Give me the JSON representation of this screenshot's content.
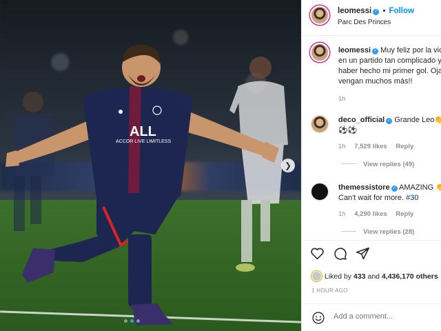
{
  "post": {
    "author": "leomessi",
    "follow_label": "Follow",
    "location": "Parc Des Princes",
    "caption": "Muy feliz por la victoria en un partido tan complicado y por haber hecho mi primer gol. Ojalá vengan muchos más!!",
    "caption_time": "1h"
  },
  "comments": [
    {
      "user": "deco_official",
      "text": "Grande Leo👏",
      "emoji_line": "⚽⚽",
      "time": "1h",
      "likes": "7,529 likes",
      "reply_label": "Reply",
      "view_replies": "View replies (49)"
    },
    {
      "user": "themessistore",
      "text": "AMAZING 👏",
      "text_line2": "Can't wait for more.",
      "hashtag": "#30",
      "time": "1h",
      "likes": "4,290 likes",
      "reply_label": "Reply",
      "view_replies": "View replies (28)"
    }
  ],
  "engagement": {
    "liked_prefix": "Liked by",
    "liked_user": "433",
    "liked_and": "and",
    "liked_count": "4,436,170 others",
    "posted_ago": "1 HOUR AGO"
  },
  "composer": {
    "placeholder": "Add a comment..."
  },
  "carousel": {
    "count": 3,
    "active": 2
  },
  "colors": {
    "accent": "#0095f6",
    "verified": "#3897f0",
    "muted": "#8e8e8e"
  },
  "icons": [
    "heart-icon",
    "comment-icon",
    "share-icon",
    "smile-icon",
    "chevron-right-icon",
    "verified-icon"
  ]
}
